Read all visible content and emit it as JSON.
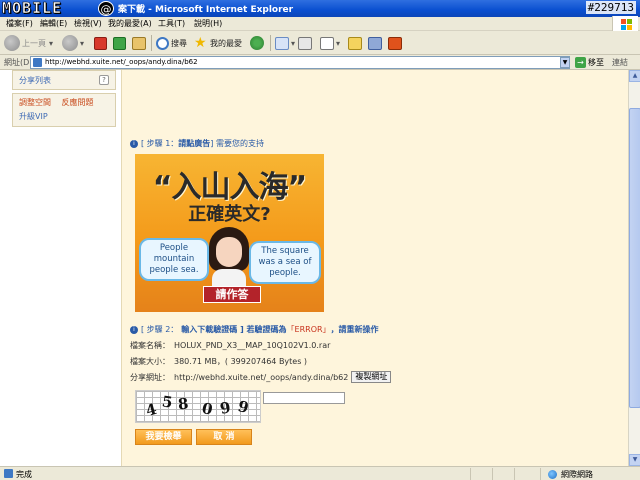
{
  "titlebar": {
    "logo_text": "MOBILE",
    "logo_badge": "@",
    "title": "案下載 - Microsoft Internet Explorer",
    "watermark": "#229713"
  },
  "menu": [
    "檔案(F)",
    "編輯(E)",
    "檢視(V)",
    "我的最愛(A)",
    "工具(T)",
    "說明(H)"
  ],
  "toolbar": {
    "back": "上一頁",
    "search": "搜尋",
    "favorites": "我的最愛"
  },
  "address": {
    "label": "網址(D)",
    "url": "http://webhd.xuite.net/_oops/andy.dina/b62",
    "go": "移至",
    "links": "連結"
  },
  "sidebar": {
    "share_list": "分享列表",
    "help_glyph": "?",
    "adjust_space": "調整空間",
    "report_issue": "反應問題",
    "upgrade_vip": "升級VIP"
  },
  "step1": {
    "num": "i",
    "prefix": "[ 步驟 1：",
    "highlight": "請點廣告",
    "suffix": "] 需要您的支持"
  },
  "ad": {
    "headline": "“入山入海”",
    "subline": "正確英文?",
    "bubble_left": "People mountain people sea.",
    "bubble_right": "The square was a sea of people.",
    "button": "請作答"
  },
  "step2": {
    "num": "i",
    "prefix": "[ 步驟 2：",
    "text1": "輸入下載驗證碼 ] 若驗證碼為",
    "error": "「ERROR」",
    "text2": "，請重新操作"
  },
  "file": {
    "name_label": "檔案名稱：",
    "name": "HOLUX_PND_X3__MAP_10Q102V1.0.rar",
    "size_label": "檔案大小：",
    "size": "380.71 MB，( 399207464 Bytes )",
    "share_label": "分享網址：",
    "share_url": "http://webhd.xuite.net/_oops/andy.dina/b62",
    "copy_button": "複製網址"
  },
  "captcha": {
    "chars": [
      "4",
      "5",
      "8",
      "0",
      "9",
      "9"
    ],
    "input_value": ""
  },
  "actions": {
    "submit": "我要檢舉",
    "cancel": "取 消"
  },
  "status": {
    "text": "完成",
    "zone": "網際網路"
  },
  "colors": {
    "panel_bg": "#fef5dc",
    "link_blue": "#2a5ba7",
    "accent_orange": "#f29a1d",
    "error_red": "#c8321c"
  }
}
